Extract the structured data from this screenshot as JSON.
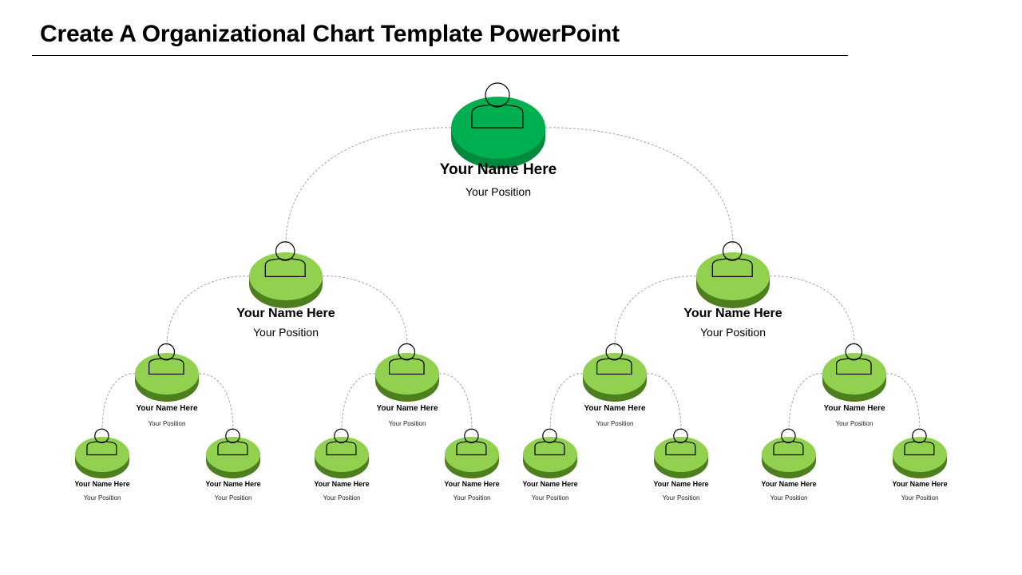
{
  "title": "Create A Organizational Chart Template PowerPoint",
  "colors": {
    "root_top": "#00B050",
    "root_side": "#00883D",
    "node_top": "#92D050",
    "node_side": "#4E7F1E",
    "connector": "#A6A6A6",
    "icon_stroke": "#000000"
  },
  "nodes": [
    {
      "id": "root",
      "level": 0,
      "parent": null,
      "name": "Your Name Here",
      "position": "Your Position",
      "icon": "person-icon"
    },
    {
      "id": "l1a",
      "level": 1,
      "parent": "root",
      "name": "Your Name Here",
      "position": "Your Position",
      "icon": "person-icon"
    },
    {
      "id": "l1b",
      "level": 1,
      "parent": "root",
      "name": "Your Name Here",
      "position": "Your Position",
      "icon": "person-icon"
    },
    {
      "id": "l2a",
      "level": 2,
      "parent": "l1a",
      "name": "Your Name Here",
      "position": "Your Position",
      "icon": "person-icon"
    },
    {
      "id": "l2b",
      "level": 2,
      "parent": "l1a",
      "name": "Your Name Here",
      "position": "Your Position",
      "icon": "person-icon"
    },
    {
      "id": "l2c",
      "level": 2,
      "parent": "l1b",
      "name": "Your Name Here",
      "position": "Your Position",
      "icon": "person-icon"
    },
    {
      "id": "l2d",
      "level": 2,
      "parent": "l1b",
      "name": "Your Name Here",
      "position": "Your Position",
      "icon": "person-icon"
    },
    {
      "id": "l3a",
      "level": 3,
      "parent": "l2a",
      "name": "Your Name Here",
      "position": "Your Position",
      "icon": "person-icon"
    },
    {
      "id": "l3b",
      "level": 3,
      "parent": "l2a",
      "name": "Your Name Here",
      "position": "Your Position",
      "icon": "person-icon"
    },
    {
      "id": "l3c",
      "level": 3,
      "parent": "l2b",
      "name": "Your Name Here",
      "position": "Your Position",
      "icon": "person-icon"
    },
    {
      "id": "l3d",
      "level": 3,
      "parent": "l2b",
      "name": "Your Name Here",
      "position": "Your Position",
      "icon": "person-icon"
    },
    {
      "id": "l3e",
      "level": 3,
      "parent": "l2c",
      "name": "Your Name Here",
      "position": "Your Position",
      "icon": "person-icon"
    },
    {
      "id": "l3f",
      "level": 3,
      "parent": "l2c",
      "name": "Your Name Here",
      "position": "Your Position",
      "icon": "person-icon"
    },
    {
      "id": "l3g",
      "level": 3,
      "parent": "l2d",
      "name": "Your Name Here",
      "position": "Your Position",
      "icon": "person-icon"
    },
    {
      "id": "l3h",
      "level": 3,
      "parent": "l2d",
      "name": "Your Name Here",
      "position": "Your Position",
      "icon": "person-icon"
    }
  ]
}
